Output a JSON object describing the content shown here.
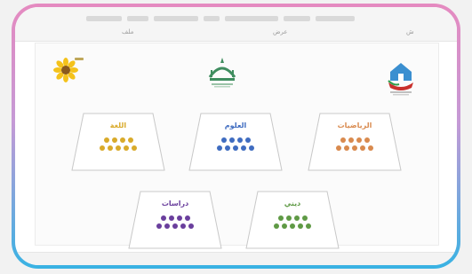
{
  "toolbar": {
    "labels": [
      "ملف",
      "عرض",
      "ش"
    ]
  },
  "cards": [
    {
      "title": "اللغة",
      "color": "#d9aa2a",
      "rows": [
        4,
        5
      ]
    },
    {
      "title": "العلوم",
      "color": "#3f6cc0",
      "rows": [
        4,
        5
      ]
    },
    {
      "title": "الرياضيات",
      "color": "#d98a4e",
      "rows": [
        4,
        5
      ]
    },
    {
      "title": "دراسات",
      "color": "#6a3f9d",
      "rows": [
        4,
        5
      ]
    },
    {
      "title": "ديني",
      "color": "#5f9a45",
      "rows": [
        4,
        5
      ]
    }
  ],
  "colors": {
    "frame_top": "#e58ac0",
    "frame_bottom": "#38b2e3",
    "trap_border": "#bdbdbd"
  },
  "icons": [
    "sunflower-logo",
    "crown-logo",
    "hands-house-logo"
  ]
}
